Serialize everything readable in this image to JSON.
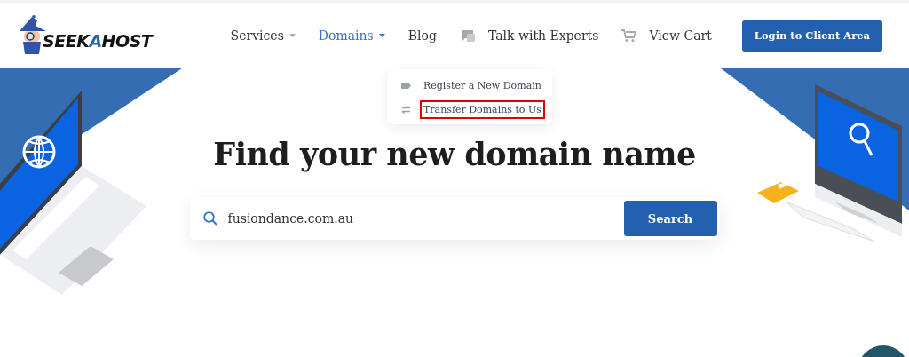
{
  "logo": {
    "parts": [
      {
        "text": "SEEK",
        "accent": false
      },
      {
        "text": "A",
        "accent": true
      },
      {
        "text": "HOST",
        "accent": false
      }
    ]
  },
  "nav": [
    {
      "label": "Services",
      "kind": "dropdown",
      "selected": false
    },
    {
      "label": "Domains",
      "kind": "dropdown",
      "selected": true
    },
    {
      "label": "Blog",
      "kind": "link",
      "selected": false
    },
    {
      "label": "Talk with Experts",
      "kind": "experts",
      "selected": false
    },
    {
      "label": "View Cart",
      "kind": "cart",
      "selected": false
    }
  ],
  "login_button": "Login to Client Area",
  "dropdown": {
    "items": [
      {
        "label": "Register a New Domain",
        "kind": "register",
        "highlighted": false
      },
      {
        "label": "Transfer Domains to Us",
        "kind": "transfer",
        "highlighted": true
      }
    ]
  },
  "hero": {
    "title": "Find your new domain name",
    "search": {
      "value": "fusiondance.com.au",
      "button": "Search"
    }
  }
}
